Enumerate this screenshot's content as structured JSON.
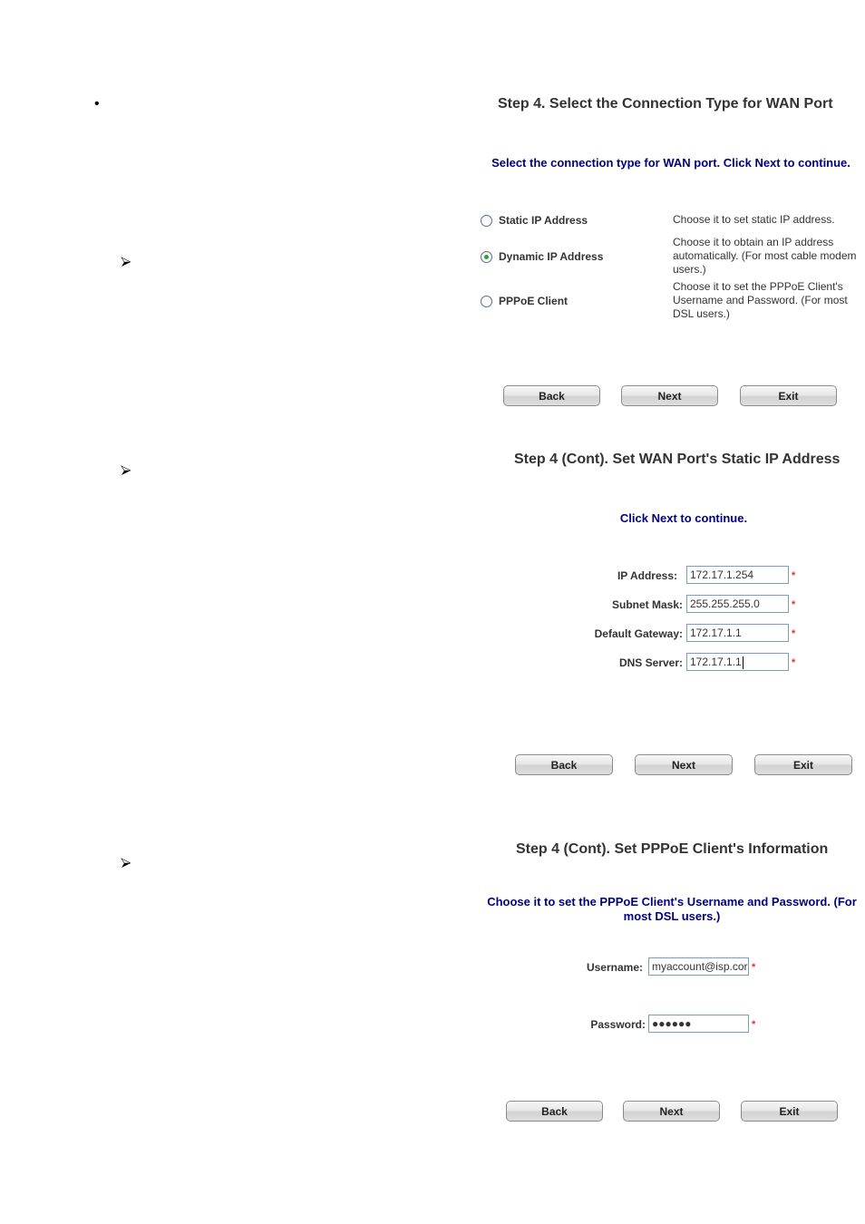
{
  "left_column": {
    "bullet_glyph": "•",
    "arrow_icon": "arrowhead-right-icon"
  },
  "step4": {
    "title": "Step 4. Select the Connection Type for WAN Port",
    "subtitle": "Select the connection type for WAN port. Click Next to continue.",
    "options": [
      {
        "label": "Static IP Address",
        "description": "Choose it to set static IP address.",
        "checked": false
      },
      {
        "label": "Dynamic IP Address",
        "description": "Choose it to obtain an IP address automatically. (For most cable modem users.)",
        "checked": true
      },
      {
        "label": "PPPoE Client",
        "description": "Choose it to set the PPPoE Client's Username and Password. (For most DSL users.)",
        "checked": false
      }
    ],
    "buttons": {
      "back": "Back",
      "next": "Next",
      "exit": "Exit"
    }
  },
  "step4_static": {
    "title": "Step 4 (Cont). Set WAN Port's Static IP Address",
    "subtitle": "Click Next to continue.",
    "fields": [
      {
        "label": "IP Address:",
        "value": "172.17.1.254",
        "required_mark": "*"
      },
      {
        "label": "Subnet Mask:",
        "value": "255.255.255.0",
        "required_mark": "*"
      },
      {
        "label": "Default Gateway:",
        "value": "172.17.1.1",
        "required_mark": "*"
      },
      {
        "label": "DNS Server:",
        "value": "172.17.1.1",
        "required_mark": "*"
      }
    ],
    "buttons": {
      "back": "Back",
      "next": "Next",
      "exit": "Exit"
    }
  },
  "step4_pppoe": {
    "title": "Step 4 (Cont). Set PPPoE Client's Information",
    "subtitle": "Choose it to set the PPPoE Client's Username and Password. (For most DSL users.)",
    "fields": [
      {
        "label": "Username:",
        "value": "myaccount@isp.cor",
        "required_mark": "*"
      },
      {
        "label": "Password:",
        "value": "●●●●●●",
        "required_mark": "*"
      }
    ],
    "buttons": {
      "back": "Back",
      "next": "Next",
      "exit": "Exit"
    }
  },
  "colors": {
    "title": "#333333",
    "subtitle": "#000080",
    "required": "#e03030",
    "input_border": "#7a9cc0",
    "radio_dot": "#2da52d"
  }
}
